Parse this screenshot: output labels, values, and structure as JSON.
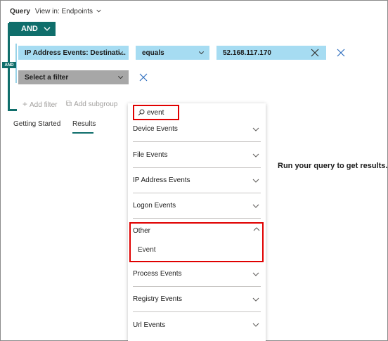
{
  "topbar": {
    "query_label": "Query",
    "view_label": "View in: Endpoints"
  },
  "group": {
    "operator": "AND",
    "sub_operator": "AND"
  },
  "filters": [
    {
      "field": "IP Address Events: Destinati...",
      "operator": "equals",
      "value": "52.168.117.170"
    },
    {
      "field": "Select a filter"
    }
  ],
  "actions": {
    "add_filter": "Add filter",
    "add_subgroup": "Add subgroup"
  },
  "tabs": [
    {
      "label": "Getting Started"
    },
    {
      "label": "Results",
      "active": true
    }
  ],
  "results": {
    "empty_message": "Run your query to get results."
  },
  "dropdown": {
    "search_value": "event",
    "categories": [
      "Device Events",
      "File Events",
      "IP Address Events",
      "Logon Events"
    ],
    "expanded": {
      "label": "Other",
      "items": [
        "Event"
      ]
    },
    "categories_after": [
      "Process Events",
      "Registry Events",
      "Url Events"
    ]
  },
  "colors": {
    "accent": "#0f6e6b",
    "filter_blue": "#a6dcf2",
    "highlight": "#e00000"
  }
}
